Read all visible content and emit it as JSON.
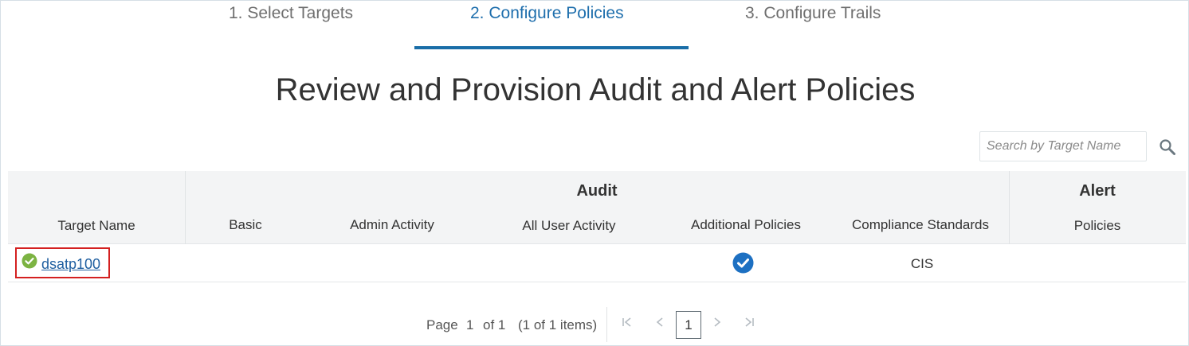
{
  "wizard": {
    "steps": [
      {
        "label": "1. Select Targets"
      },
      {
        "label": "2. Configure Policies"
      },
      {
        "label": "3. Configure Trails"
      }
    ]
  },
  "page": {
    "title": "Review and Provision Audit and Alert Policies"
  },
  "search": {
    "placeholder": "Search by Target Name",
    "value": ""
  },
  "table": {
    "groups": {
      "audit": "Audit",
      "alert": "Alert"
    },
    "columns": {
      "target_name": "Target Name",
      "basic": "Basic",
      "admin_activity": "Admin Activity",
      "all_user_activity": "All User Activity",
      "additional_policies": "Additional Policies",
      "compliance_standards": "Compliance Standards",
      "policies": "Policies"
    },
    "rows": [
      {
        "target_name": "dsatp100",
        "compliance_standards": "CIS"
      }
    ]
  },
  "pagination": {
    "page_label": "Page",
    "current_page": "1",
    "of_label": "of 1",
    "items_label": "(1 of 1 items)",
    "page_button": "1"
  },
  "colors": {
    "accent": "#1a6ea8",
    "success": "#7cb342",
    "check": "#1d70c2",
    "highlight": "#d42020"
  }
}
